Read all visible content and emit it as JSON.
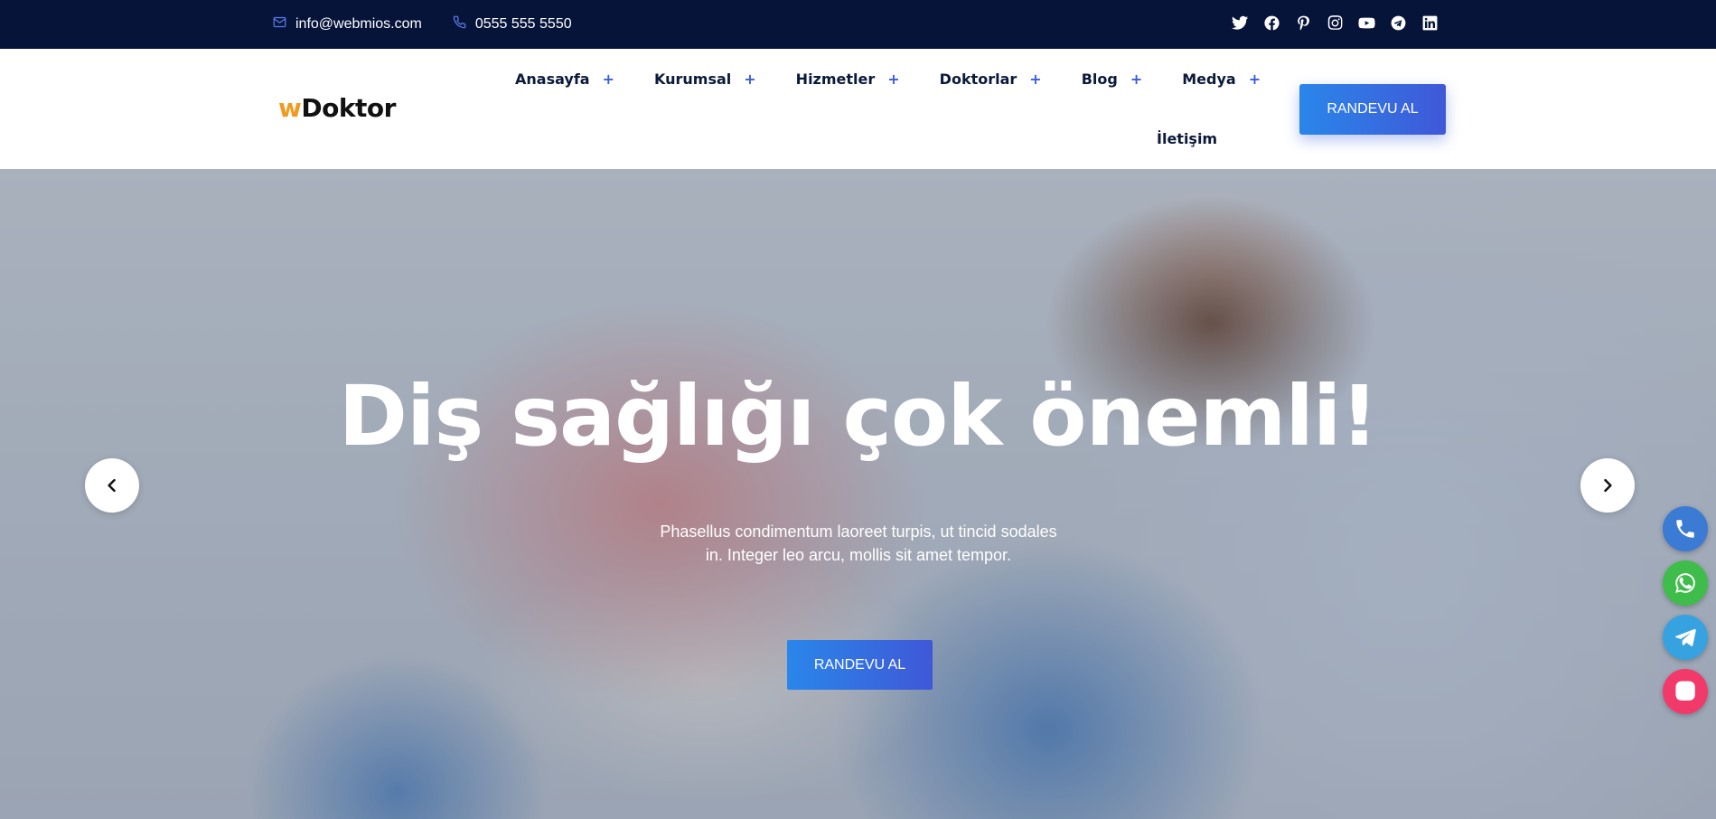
{
  "topbar": {
    "email": "info@webmios.com",
    "phone": "0555 555 5550",
    "socials": [
      "twitter-icon",
      "facebook-icon",
      "pinterest-icon",
      "instagram-icon",
      "youtube-icon",
      "telegram-icon",
      "linkedin-icon"
    ]
  },
  "header": {
    "logo_w": "w",
    "logo_rest": "Doktor",
    "nav": [
      {
        "label": "Anasayfa",
        "plus": "+"
      },
      {
        "label": "Kurumsal",
        "plus": "+"
      },
      {
        "label": "Hizmetler",
        "plus": "+"
      },
      {
        "label": "Doktorlar",
        "plus": "+"
      },
      {
        "label": "Blog",
        "plus": "+"
      },
      {
        "label": "Medya",
        "plus": "+"
      },
      {
        "label": "İletişim"
      }
    ],
    "cta_label": "RANDEVU AL"
  },
  "hero": {
    "title": "Diş sağlığı çok önemli!",
    "description": "Phasellus condimentum laoreet turpis, ut tincid sodales in. Integer leo arcu, mollis sit amet tempor.",
    "button_label": "RANDEVU AL"
  },
  "floating": {
    "buttons": [
      {
        "icon": "phone-icon",
        "color": "#3b7bd4"
      },
      {
        "icon": "whatsapp-icon",
        "color": "#3fbd4a"
      },
      {
        "icon": "telegram-icon",
        "color": "#36a3e0"
      },
      {
        "icon": "instagram-icon",
        "color": "#f23a6a"
      }
    ]
  },
  "colors": {
    "topbar_bg": "#07143a",
    "accent_blue": "#2a86ea",
    "nav_plus": "#3a5ce0",
    "logo_orange": "#f29a1f"
  }
}
